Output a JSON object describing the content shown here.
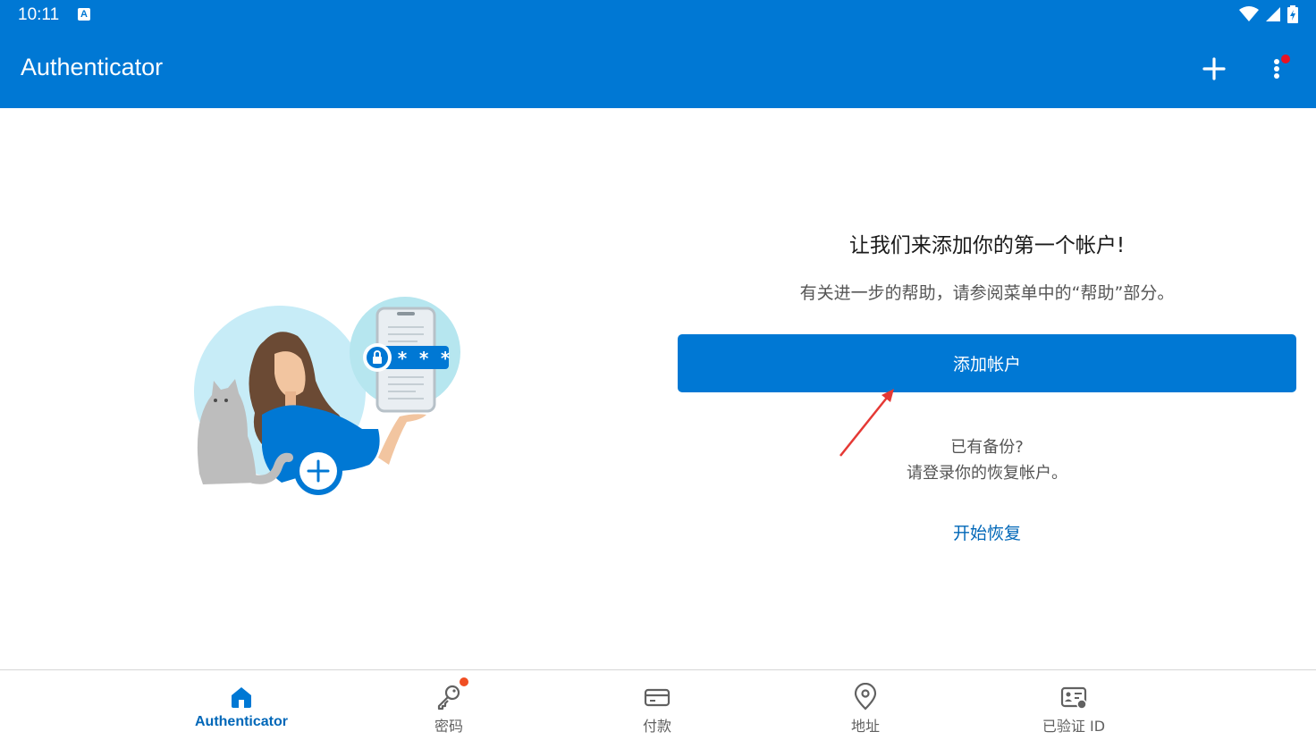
{
  "status_bar": {
    "time": "10:11",
    "notification_glyph": "A"
  },
  "app_bar": {
    "title": "Authenticator",
    "actions": [
      "plus-icon",
      "more-vertical-icon"
    ]
  },
  "main": {
    "title": "让我们来添加你的第一个帐户!",
    "subtitle": "有关进一步的帮助，请参阅菜单中的“帮助”部分。",
    "add_account_button": "添加帐户",
    "backup_question": "已有备份?",
    "backup_hint": "请登录你的恢复帐户。",
    "recover_link": "开始恢复",
    "password_mask": "* * *"
  },
  "bottom_nav": {
    "items": [
      {
        "label": "Authenticator",
        "icon": "home-icon",
        "active": true
      },
      {
        "label": "密码",
        "icon": "key-icon",
        "badge": true
      },
      {
        "label": "付款",
        "icon": "credit-card-icon"
      },
      {
        "label": "地址",
        "icon": "location-pin-icon"
      },
      {
        "label": "已验证 ID",
        "icon": "verified-id-icon"
      }
    ]
  },
  "colors": {
    "brand": "#0078d4",
    "link": "#0067b8",
    "badge": "#f04e23"
  }
}
